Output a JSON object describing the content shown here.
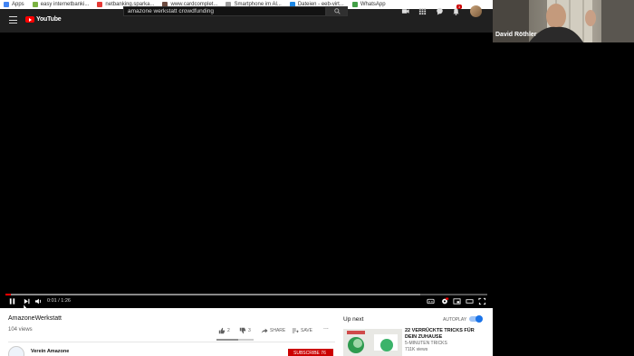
{
  "bookmarks": [
    {
      "label": "Apps",
      "color": "#4285f4"
    },
    {
      "label": "easy internetbanki...",
      "color": "#7cb342"
    },
    {
      "label": "netbanking.sparka...",
      "color": "#e53935"
    },
    {
      "label": "www.cardcomplet...",
      "color": "#6d4c41"
    },
    {
      "label": "Smartphone im Al...",
      "color": "#9e9e9e"
    },
    {
      "label": "Dateien - eeb-virt...",
      "color": "#1e88e5"
    },
    {
      "label": "WhatsApp",
      "color": "#43a047"
    }
  ],
  "bookmarks_more": "»",
  "youtube": {
    "logo_text": "YouTube",
    "search_value": "amazone werkstatt crowdfunding",
    "notification_count": "3"
  },
  "player": {
    "time": "0:01 / 1:26",
    "progress": 0.012
  },
  "video": {
    "title": "AmazoneWerkstatt",
    "views": "104 views",
    "likes": "2",
    "dislikes": "3",
    "share_label": "SHARE",
    "save_label": "SAVE",
    "more_label": "...",
    "channel_name": "Verein Amazone",
    "subscribe_label": "SUBSCRIBE 76"
  },
  "sidebar": {
    "up_next": "Up next",
    "autoplay": "AUTOPLAY",
    "rec_title": "22 VERRÜCKTE TRICKS FÜR DEIN ZUHAUSE",
    "rec_channel": "5-MINUTEN TRICKS",
    "rec_views": "711K views"
  },
  "participant": {
    "name": "David Röthler"
  }
}
